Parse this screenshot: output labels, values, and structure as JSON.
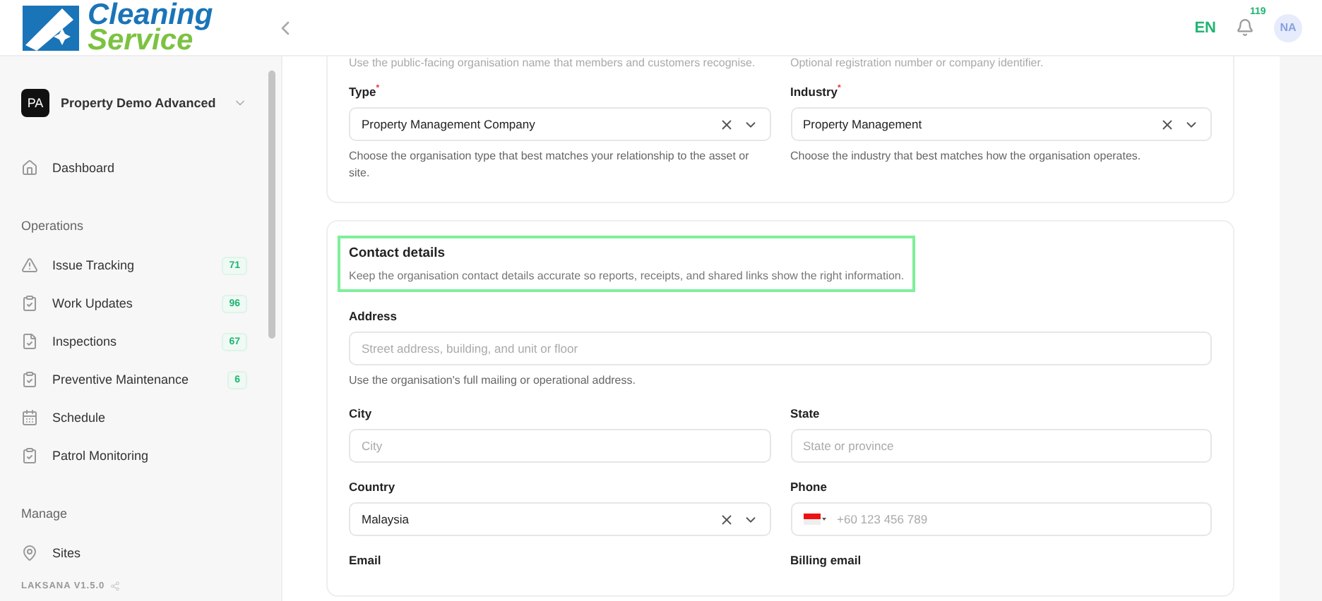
{
  "header": {
    "logo": {
      "line1": "Cleaning",
      "line2": "Service"
    },
    "language": {
      "label": "EN",
      "active": true
    },
    "notification_count": "119",
    "avatar": "NA"
  },
  "sidebar": {
    "org": {
      "initials": "PA",
      "name": "Property Demo Advanced"
    },
    "sections": [
      {
        "items": [
          {
            "kind": "home",
            "label": "Dashboard"
          }
        ]
      },
      {
        "title": "Operations",
        "items": [
          {
            "kind": "alert",
            "label": "Issue Tracking",
            "badge": "71"
          },
          {
            "kind": "clipboard",
            "label": "Work Updates",
            "badge": "96"
          },
          {
            "kind": "file",
            "label": "Inspections",
            "badge": "67"
          },
          {
            "kind": "clipboard",
            "label": "Preventive Maintenance",
            "badge": "6"
          },
          {
            "kind": "calendar",
            "label": "Schedule"
          },
          {
            "kind": "clipboard",
            "label": "Patrol Monitoring"
          }
        ]
      },
      {
        "title": "Manage",
        "items": [
          {
            "kind": "pin",
            "label": "Sites"
          }
        ]
      }
    ],
    "version": "LAKSANA V1.5.0"
  },
  "cards": [
    {
      "top_hints": [
        "Use the public-facing organisation name that members and customers recognise.",
        "Optional registration number or company identifier."
      ],
      "fields": [
        {
          "kind": "select",
          "label": "Type",
          "required_mark": "*",
          "value": "Property Management Company",
          "hint": "Choose the organisation type that best matches your relationship to the asset or site."
        },
        {
          "kind": "select",
          "label": "Industry",
          "required_mark": "*",
          "value": "Property Management",
          "hint": "Choose the industry that best matches how the organisation operates."
        }
      ]
    },
    {
      "title": "Contact details",
      "description": "Keep the organisation contact details accurate so reports, receipts, and shared links show the right information.",
      "highlighted": true,
      "fields": [
        {
          "kind": "input",
          "label": "Address",
          "wide": true,
          "placeholder": "Street address, building, and unit or floor",
          "hint": "Use the organisation's full mailing or operational address."
        },
        {
          "kind": "input",
          "label": "City",
          "placeholder": "City"
        },
        {
          "kind": "input",
          "label": "State",
          "placeholder": "State or province"
        },
        {
          "kind": "select",
          "label": "Country",
          "value": "Malaysia"
        },
        {
          "kind": "phone",
          "label": "Phone",
          "placeholder": "+60 123 456 789"
        },
        {
          "kind": "label",
          "label": "Email"
        },
        {
          "kind": "label",
          "label": "Billing email"
        }
      ]
    }
  ]
}
